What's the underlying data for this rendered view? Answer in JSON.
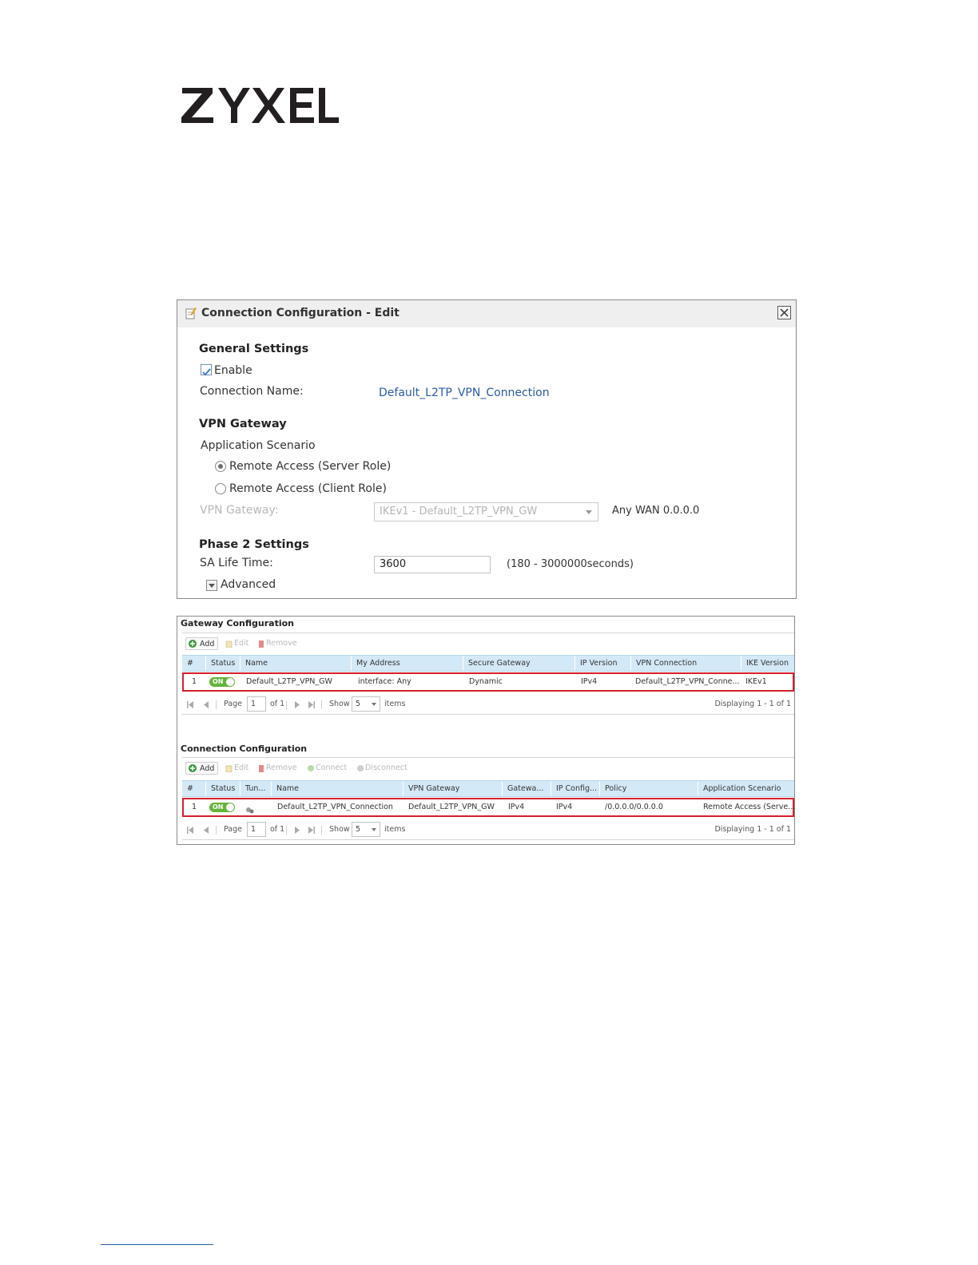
{
  "logo": {
    "text": "ZYXEL"
  },
  "dialog": {
    "title": "Connection Configuration - Edit",
    "general_settings": "General Settings",
    "enable_label": "Enable",
    "enable_checked": true,
    "connection_name_label": "Connection Name:",
    "connection_name_value": "Default_L2TP_VPN_Connection",
    "vpn_gateway_heading": "VPN Gateway",
    "application_scenario_label": "Application Scenario",
    "scenario_server": "Remote Access (Server Role)",
    "scenario_client": "Remote Access (Client Role)",
    "scenario_selected": "server",
    "vpn_gateway_label": "VPN Gateway:",
    "vpn_gateway_select": "IKEv1 - Default_L2TP_VPN_GW",
    "vpn_gateway_info": "Any WAN 0.0.0.0",
    "phase2_heading": "Phase 2 Settings",
    "sa_life_label": "SA Life Time:",
    "sa_life_value": "3600",
    "sa_life_range": "(180 - 3000000seconds)",
    "advanced_label": "Advanced"
  },
  "gateway": {
    "title": "Gateway Configuration",
    "toolbar": {
      "add": "Add",
      "edit": "Edit",
      "remove": "Remove"
    },
    "columns": [
      "#",
      "Status",
      "Name",
      "My Address",
      "Secure Gateway",
      "IP Version",
      "VPN Connection",
      "IKE Version"
    ],
    "row": {
      "num": "1",
      "status": "ON",
      "name": "Default_L2TP_VPN_GW",
      "my_address": "interface: Any",
      "secure_gateway": "Dynamic",
      "ip_version": "IPv4",
      "vpn_connection": "Default_L2TP_VPN_Conne...",
      "ike_version": "IKEv1"
    },
    "pager": {
      "page_label": "Page",
      "page_value": "1",
      "of_label": "of 1",
      "show_label": "Show",
      "show_value": "5",
      "items_label": "items",
      "displaying": "Displaying 1 - 1 of 1"
    }
  },
  "connection": {
    "title": "Connection Configuration",
    "toolbar": {
      "add": "Add",
      "edit": "Edit",
      "remove": "Remove",
      "connect": "Connect",
      "disconnect": "Disconnect"
    },
    "columns": [
      "#",
      "Status",
      "Tun...",
      "Name",
      "VPN Gateway",
      "Gatewa...",
      "IP Config...",
      "Policy",
      "Application Scenario"
    ],
    "row": {
      "num": "1",
      "status": "ON",
      "name": "Default_L2TP_VPN_Connection",
      "vpn_gateway": "Default_L2TP_VPN_GW",
      "gateway_ip": "IPv4",
      "ip_config": "IPv4",
      "policy": "/0.0.0.0/0.0.0.0",
      "application_scenario": "Remote Access (Serve..."
    },
    "pager": {
      "page_label": "Page",
      "page_value": "1",
      "of_label": "of 1",
      "show_label": "Show",
      "show_value": "5",
      "items_label": "items",
      "displaying": "Displaying 1 - 1 of 1"
    }
  },
  "colors": {
    "accent_link": "#2b5aa8",
    "highlight_row": "#d3202b",
    "toggle_on": "#64b53a",
    "grid_header": "#d4e9f7"
  }
}
